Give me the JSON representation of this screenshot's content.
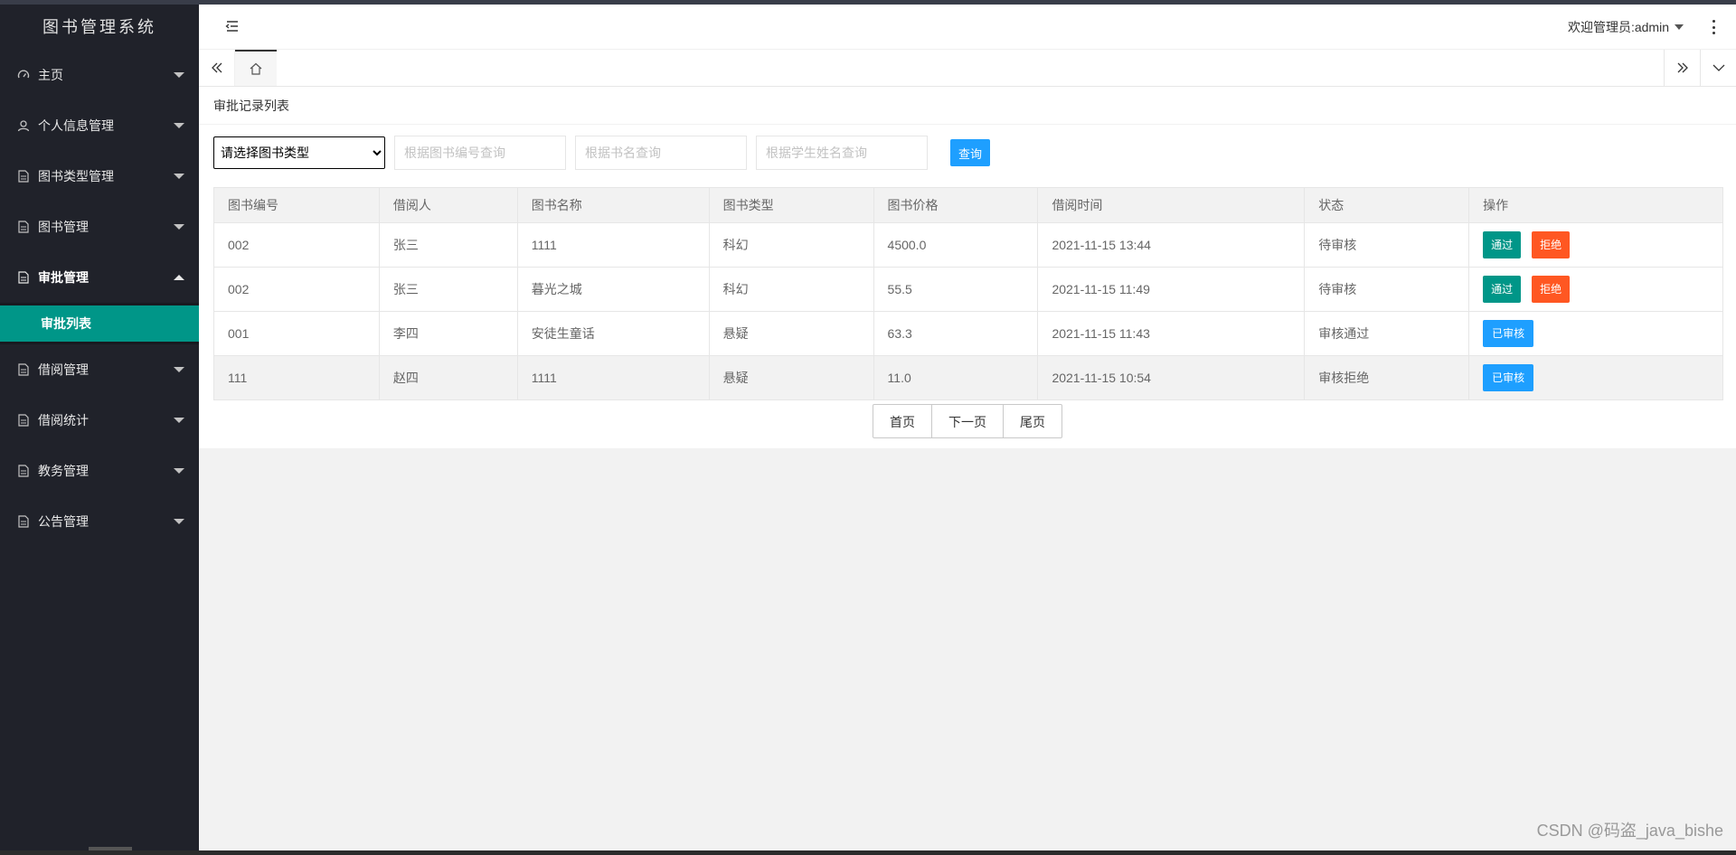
{
  "app": {
    "title": "图书管理系统"
  },
  "sidebar": {
    "items": [
      {
        "label": "主页",
        "icon": "dashboard-icon"
      },
      {
        "label": "个人信息管理",
        "icon": "user-icon"
      },
      {
        "label": "图书类型管理",
        "icon": "file-icon"
      },
      {
        "label": "图书管理",
        "icon": "file-icon"
      },
      {
        "label": "审批管理",
        "icon": "file-icon",
        "expanded": true
      },
      {
        "label": "借阅管理",
        "icon": "file-icon"
      },
      {
        "label": "借阅统计",
        "icon": "file-icon"
      },
      {
        "label": "教务管理",
        "icon": "file-icon"
      },
      {
        "label": "公告管理",
        "icon": "file-icon"
      }
    ],
    "subitems": [
      {
        "label": "审批列表",
        "active": true
      }
    ]
  },
  "header": {
    "welcome": "欢迎管理员:admin"
  },
  "page": {
    "title": "审批记录列表"
  },
  "filters": {
    "select_value": "请选择图书类型",
    "book_no_placeholder": "根据图书编号查询",
    "book_name_placeholder": "根据书名查询",
    "student_placeholder": "根据学生姓名查询",
    "search_label": "查询"
  },
  "table": {
    "headers": [
      "图书编号",
      "借阅人",
      "图书名称",
      "图书类型",
      "图书价格",
      "借阅时间",
      "状态",
      "操作"
    ],
    "rows": [
      {
        "no": "002",
        "borrower": "张三",
        "name": "1111",
        "type": "科幻",
        "price": "4500.0",
        "time": "2021-11-15 13:44",
        "status": "待审核",
        "status_kind": "pending",
        "actions": [
          "通过",
          "拒绝"
        ]
      },
      {
        "no": "002",
        "borrower": "张三",
        "name": "暮光之城",
        "type": "科幻",
        "price": "55.5",
        "time": "2021-11-15 11:49",
        "status": "待审核",
        "status_kind": "pending",
        "actions": [
          "通过",
          "拒绝"
        ]
      },
      {
        "no": "001",
        "borrower": "李四",
        "name": "安徒生童话",
        "type": "悬疑",
        "price": "63.3",
        "time": "2021-11-15 11:43",
        "status": "审核通过",
        "status_kind": "pass",
        "actions": [
          "已审核"
        ]
      },
      {
        "no": "111",
        "borrower": "赵四",
        "name": "1111",
        "type": "悬疑",
        "price": "11.0",
        "time": "2021-11-15 10:54",
        "status": "审核拒绝",
        "status_kind": "reject",
        "actions": [
          "已审核"
        ]
      }
    ]
  },
  "pager": {
    "first": "首页",
    "next": "下一页",
    "last": "尾页"
  },
  "watermark": "CSDN @码盗_java_bishe",
  "colors": {
    "sidebar_bg": "#20222a",
    "active": "#009688",
    "primary": "#1e9fff",
    "danger": "#ff5722"
  }
}
